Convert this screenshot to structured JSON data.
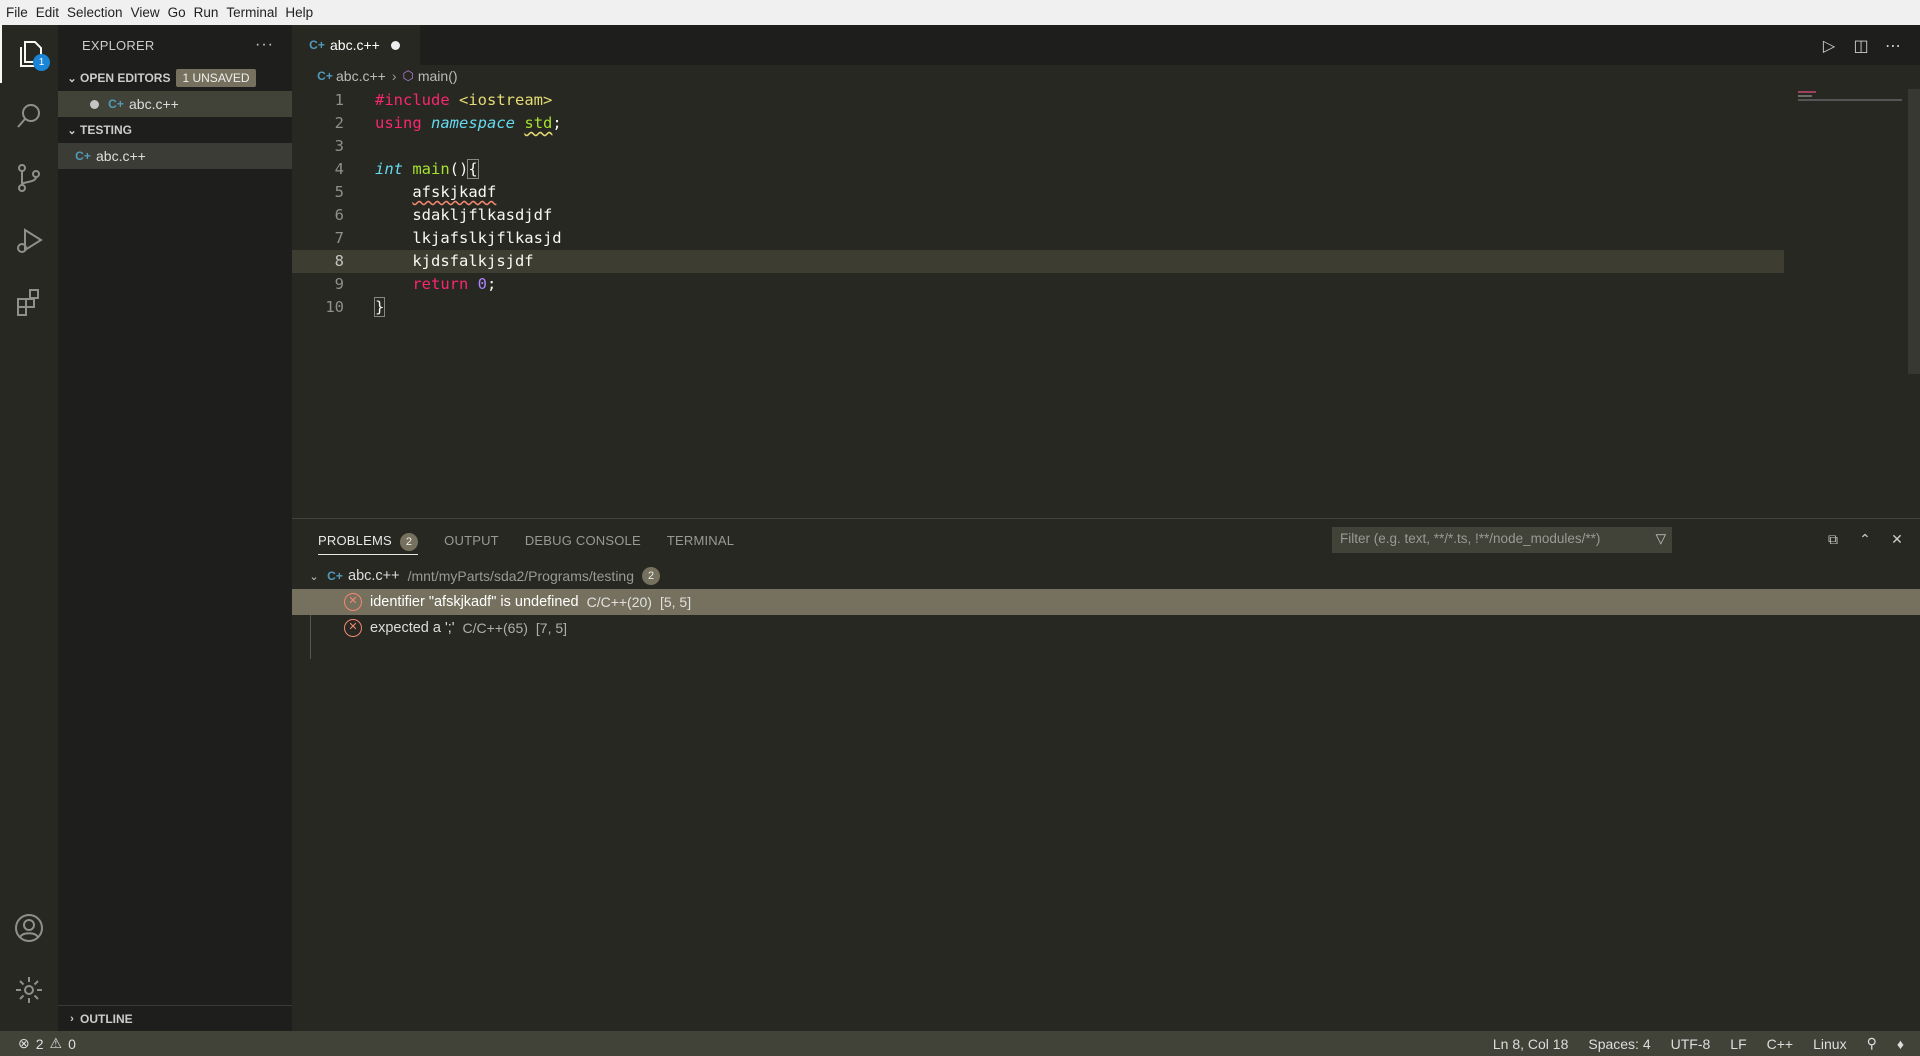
{
  "menu": [
    "File",
    "Edit",
    "Selection",
    "View",
    "Go",
    "Run",
    "Terminal",
    "Help"
  ],
  "activity": {
    "explorer_badge": "1"
  },
  "sidebar": {
    "title": "EXPLORER",
    "more": "···",
    "open_editors": {
      "label": "OPEN EDITORS",
      "unsaved_badge": "1 UNSAVED",
      "items": [
        {
          "name": "abc.c++"
        }
      ]
    },
    "folder": {
      "label": "TESTING",
      "items": [
        {
          "name": "abc.c++"
        }
      ]
    },
    "outline": {
      "label": "OUTLINE"
    }
  },
  "editor": {
    "tab": {
      "label": "abc.c++"
    },
    "breadcrumb": {
      "file": "abc.c++",
      "symbol": "main()"
    },
    "line_numbers": [
      "1",
      "2",
      "3",
      "4",
      "5",
      "6",
      "7",
      "8",
      "9",
      "10"
    ],
    "lines": {
      "l1_kw": "#include",
      "l1_str": "<iostream>",
      "l2_kw": "using",
      "l2_ns": "namespace",
      "l2_std": "std",
      "l2_semi": ";",
      "l4_type": "int",
      "l4_fn": "main",
      "l4_rest": "()",
      "l4_brace": "{",
      "l5": "afskjkadf",
      "l6": "sdakljflkasdjdf",
      "l7": "lkjafslkjflkasjd",
      "l8": "kjdsfalkjsjdf",
      "l9_kw": "return",
      "l9_num": "0",
      "l9_semi": ";",
      "l10": "}"
    }
  },
  "panel": {
    "tabs": {
      "problems": "PROBLEMS",
      "problems_count": "2",
      "output": "OUTPUT",
      "debug_console": "DEBUG CONSOLE",
      "terminal": "TERMINAL"
    },
    "filter_placeholder": "Filter (e.g. text, **/*.ts, !**/node_modules/**)",
    "file": {
      "name": "abc.c++",
      "path": "/mnt/myParts/sda2/Programs/testing",
      "count": "2"
    },
    "problems": [
      {
        "message": "identifier \"afskjkadf\" is undefined",
        "source": "C/C++(20)",
        "position": "[5, 5]"
      },
      {
        "message": "expected a ';'",
        "source": "C/C++(65)",
        "position": "[7, 5]"
      }
    ]
  },
  "status": {
    "errors": "2",
    "warnings": "0",
    "cursor": "Ln 8, Col 18",
    "spaces": "Spaces: 4",
    "encoding": "UTF-8",
    "eol": "LF",
    "language": "C++",
    "platform": "Linux"
  }
}
